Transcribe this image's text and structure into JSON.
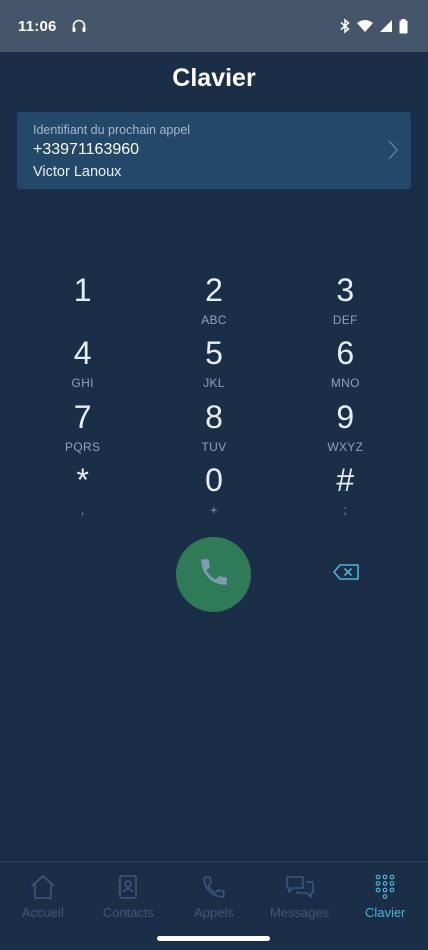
{
  "status_bar": {
    "time": "11:06"
  },
  "header": {
    "title": "Clavier"
  },
  "caller_id": {
    "label": "Identifiant du prochain appel",
    "number": "+33971163960",
    "name": "Victor Lanoux"
  },
  "keypad": [
    {
      "digit": "1",
      "letters": ""
    },
    {
      "digit": "2",
      "letters": "ABC"
    },
    {
      "digit": "3",
      "letters": "DEF"
    },
    {
      "digit": "4",
      "letters": "GHI"
    },
    {
      "digit": "5",
      "letters": "JKL"
    },
    {
      "digit": "6",
      "letters": "MNO"
    },
    {
      "digit": "7",
      "letters": "PQRS"
    },
    {
      "digit": "8",
      "letters": "TUV"
    },
    {
      "digit": "9",
      "letters": "WXYZ"
    },
    {
      "digit": "*",
      "letters": ","
    },
    {
      "digit": "0",
      "letters": "+"
    },
    {
      "digit": "#",
      "letters": ";"
    }
  ],
  "bottom_nav": {
    "items": [
      {
        "label": "Accueil",
        "icon": "home-icon"
      },
      {
        "label": "Contacts",
        "icon": "contacts-book-icon"
      },
      {
        "label": "Appels",
        "icon": "phone-icon"
      },
      {
        "label": "Messages",
        "icon": "chat-bubbles-icon"
      },
      {
        "label": "Clavier",
        "icon": "dialpad-icon",
        "active": true
      }
    ]
  },
  "colors": {
    "background": "#1a2e47",
    "status_bar": "#45566a",
    "card": "#24486a",
    "call_button": "#2f7a57",
    "accent": "#4fb3d6",
    "nav_inactive": "#3d5a7a"
  }
}
